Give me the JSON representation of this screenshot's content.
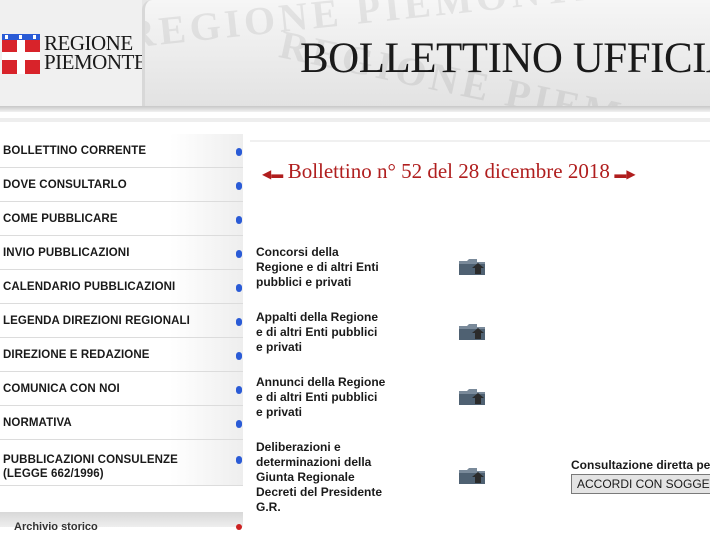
{
  "header": {
    "logo_line1": "REGIONE",
    "logo_line2": "PIEMONTE",
    "title": "BOLLETTINO UFFICIALE",
    "watermark": "REGIONE PIEMONTE"
  },
  "sidebar": {
    "items": [
      {
        "label": "BOLLETTINO CORRENTE"
      },
      {
        "label": "DOVE CONSULTARLO"
      },
      {
        "label": "COME PUBBLICARE"
      },
      {
        "label": "INVIO PUBBLICAZIONI"
      },
      {
        "label": "CALENDARIO PUBBLICAZIONI"
      },
      {
        "label": "LEGENDA DIREZIONI REGIONALI"
      },
      {
        "label": "DIREZIONE E REDAZIONE"
      },
      {
        "label": "COMUNICA CON NOI"
      },
      {
        "label": "NORMATIVA"
      },
      {
        "label": "PUBBLICAZIONI CONSULENZE (LEGGE 662/1996)"
      }
    ],
    "partial_item": "Archivio storico"
  },
  "main": {
    "bollettino_title": "Bollettino n° 52 del 28 dicembre 2018",
    "sections": [
      {
        "label": "Concorsi della Regione e di altri Enti pubblici e privati"
      },
      {
        "label": "Appalti della Regione e di altri Enti pubblici e privati"
      },
      {
        "label": "Annunci della Regione e di altri Enti pubblici e privati"
      },
      {
        "label": "Deliberazioni e determinazioni della Giunta Regionale Decreti del Presidente G.R."
      }
    ],
    "consultazione_label": "Consultazione diretta per",
    "consultazione_selected": "ACCORDI CON SOGGETTI"
  },
  "colors": {
    "title_red": "#b01e1e",
    "nav_dot": "#2a5bd6",
    "flag_red": "#d8232a"
  }
}
